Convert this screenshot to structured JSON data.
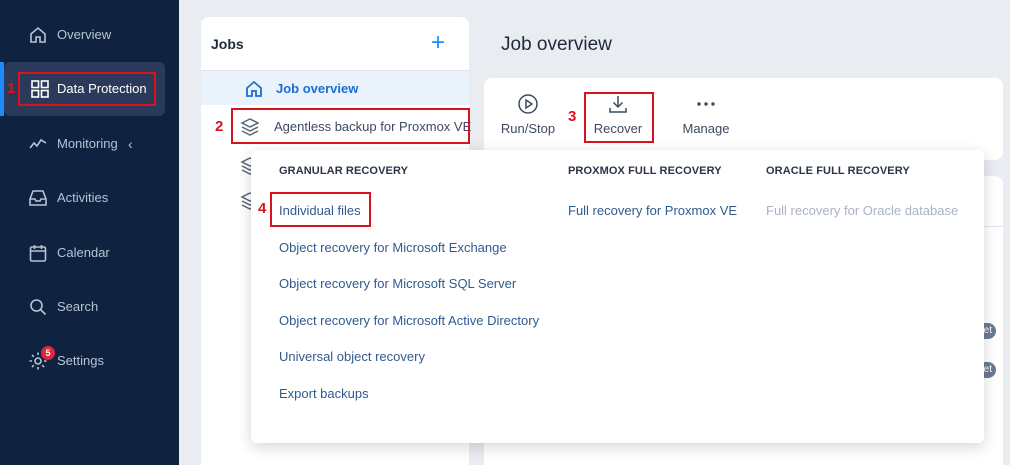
{
  "sidebar": {
    "items": [
      {
        "label": "Overview",
        "icon": "home-icon"
      },
      {
        "label": "Data Protection",
        "icon": "grid-icon",
        "active": true
      },
      {
        "label": "Monitoring",
        "icon": "activity-icon"
      },
      {
        "label": "Activities",
        "icon": "inbox-icon"
      },
      {
        "label": "Calendar",
        "icon": "calendar-icon"
      },
      {
        "label": "Search",
        "icon": "search-icon"
      },
      {
        "label": "Settings",
        "icon": "gear-icon",
        "badge": "5"
      }
    ]
  },
  "jobs": {
    "title": "Jobs",
    "add_label": "+",
    "overview_label": "Job overview",
    "rows": [
      {
        "label": "Agentless backup for Proxmox VE"
      },
      {
        "label": ""
      },
      {
        "label": ""
      }
    ]
  },
  "main": {
    "title": "Job overview",
    "toolbar": {
      "run_stop": "Run/Stop",
      "recover": "Recover",
      "manage": "Manage"
    },
    "pill_text": "et"
  },
  "dropdown": {
    "columns": [
      {
        "heading": "GRANULAR RECOVERY",
        "items": [
          "Individual files",
          "Object recovery for Microsoft Exchange",
          "Object recovery for Microsoft SQL Server",
          "Object recovery for Microsoft Active Directory",
          "Universal object recovery",
          "Export backups"
        ]
      },
      {
        "heading": "PROXMOX FULL RECOVERY",
        "items": [
          "Full recovery for Proxmox VE"
        ]
      },
      {
        "heading": "ORACLE FULL RECOVERY",
        "items": [
          "Full recovery for Oracle database"
        ],
        "disabled": true
      }
    ]
  },
  "callouts": [
    "1",
    "2",
    "3",
    "4"
  ],
  "colors": {
    "sidebar_bg": "#0f2240",
    "accent": "#1a8cff",
    "callout": "#d7141e",
    "badge": "#e0253b"
  }
}
